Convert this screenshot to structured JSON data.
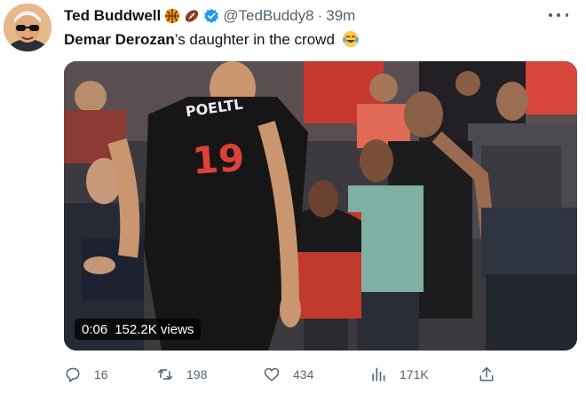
{
  "tweet": {
    "author_name": "Ted Buddwell",
    "author_handle": "@TedBuddy8",
    "separator": "·",
    "time": "39m",
    "text_bold": "Demar Derozan",
    "text_rest": "’s daughter in the crowd",
    "icons": {
      "basketball": "basketball-icon",
      "football": "football-icon",
      "verified": "verified-badge-icon",
      "laugh": "tears-of-joy-emoji",
      "more": "more-icon"
    },
    "colors": {
      "verified": "#1d9bf0",
      "secondary_text": "#536471",
      "jersey": "#161616",
      "jersey_number": "#e0403a"
    }
  },
  "media": {
    "jersey_name": "POELTL",
    "jersey_number": "19",
    "video_time": "0:06",
    "video_views": "152.2K views"
  },
  "actions": {
    "replies": "16",
    "retweets": "198",
    "likes": "434",
    "views": "171K"
  }
}
